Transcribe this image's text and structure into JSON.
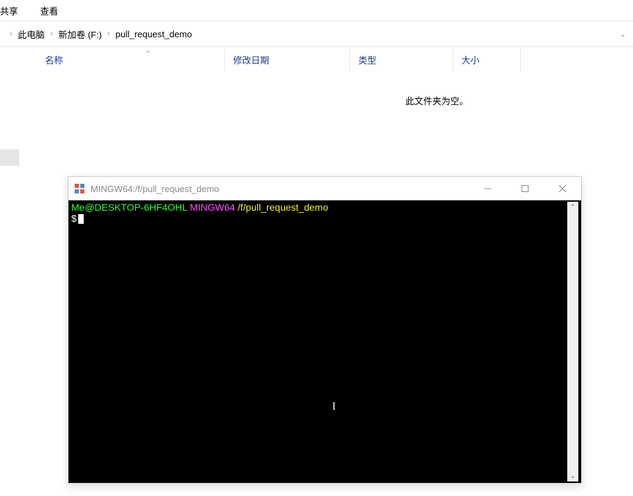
{
  "menu": {
    "share": "共享",
    "view": "查看"
  },
  "breadcrumb": {
    "parts": [
      "此电脑",
      "新加卷 (F:)",
      "pull_request_demo"
    ]
  },
  "columns": {
    "name": "名称",
    "date": "修改日期",
    "type": "类型",
    "size": "大小"
  },
  "empty_folder": "此文件夹为空。",
  "terminal": {
    "title": "MINGW64:/f/pull_request_demo",
    "prompt": {
      "user": "Me@DESKTOP-6HF4OHL",
      "env": "MINGW64",
      "path": "/f/pull_request_demo",
      "symbol": "$"
    }
  }
}
